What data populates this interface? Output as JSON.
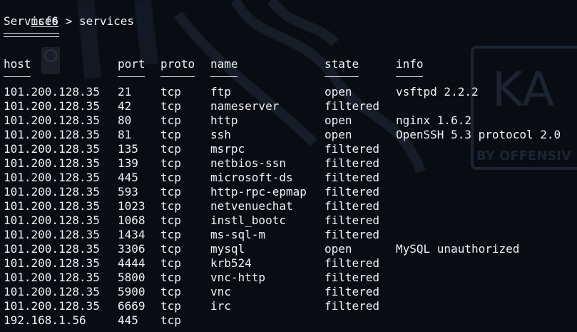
{
  "terminal": {
    "prompt_user": "msf6",
    "prompt_sep": " > ",
    "command": "services",
    "heading": "Services",
    "heading_rule": "========",
    "columns": {
      "host": "host",
      "port": "port",
      "proto": "proto",
      "name": "name",
      "state": "state",
      "info": "info"
    },
    "rows": [
      {
        "host": "101.200.128.35",
        "port": "21",
        "proto": "tcp",
        "name": "ftp",
        "state": "open",
        "info": "vsftpd 2.2.2"
      },
      {
        "host": "101.200.128.35",
        "port": "42",
        "proto": "tcp",
        "name": "nameserver",
        "state": "filtered",
        "info": ""
      },
      {
        "host": "101.200.128.35",
        "port": "80",
        "proto": "tcp",
        "name": "http",
        "state": "open",
        "info": "nginx 1.6.2"
      },
      {
        "host": "101.200.128.35",
        "port": "81",
        "proto": "tcp",
        "name": "ssh",
        "state": "open",
        "info": "OpenSSH 5.3 protocol 2.0"
      },
      {
        "host": "101.200.128.35",
        "port": "135",
        "proto": "tcp",
        "name": "msrpc",
        "state": "filtered",
        "info": ""
      },
      {
        "host": "101.200.128.35",
        "port": "139",
        "proto": "tcp",
        "name": "netbios-ssn",
        "state": "filtered",
        "info": ""
      },
      {
        "host": "101.200.128.35",
        "port": "445",
        "proto": "tcp",
        "name": "microsoft-ds",
        "state": "filtered",
        "info": ""
      },
      {
        "host": "101.200.128.35",
        "port": "593",
        "proto": "tcp",
        "name": "http-rpc-epmap",
        "state": "filtered",
        "info": ""
      },
      {
        "host": "101.200.128.35",
        "port": "1023",
        "proto": "tcp",
        "name": "netvenuechat",
        "state": "filtered",
        "info": ""
      },
      {
        "host": "101.200.128.35",
        "port": "1068",
        "proto": "tcp",
        "name": "instl_bootc",
        "state": "filtered",
        "info": ""
      },
      {
        "host": "101.200.128.35",
        "port": "1434",
        "proto": "tcp",
        "name": "ms-sql-m",
        "state": "filtered",
        "info": ""
      },
      {
        "host": "101.200.128.35",
        "port": "3306",
        "proto": "tcp",
        "name": "mysql",
        "state": "open",
        "info": "MySQL unauthorized"
      },
      {
        "host": "101.200.128.35",
        "port": "4444",
        "proto": "tcp",
        "name": "krb524",
        "state": "filtered",
        "info": ""
      },
      {
        "host": "101.200.128.35",
        "port": "5800",
        "proto": "tcp",
        "name": "vnc-http",
        "state": "filtered",
        "info": ""
      },
      {
        "host": "101.200.128.35",
        "port": "5900",
        "proto": "tcp",
        "name": "vnc",
        "state": "filtered",
        "info": ""
      },
      {
        "host": "101.200.128.35",
        "port": "6669",
        "proto": "tcp",
        "name": "irc",
        "state": "filtered",
        "info": ""
      },
      {
        "host": "192.168.1.56",
        "port": "445",
        "proto": "tcp",
        "name": "",
        "state": "",
        "info": ""
      }
    ]
  },
  "wallpaper": {
    "logo_text": "KA",
    "tagline": "BY OFFENSIV"
  },
  "colors": {
    "background": "#090c12",
    "text": "#eef1f5",
    "wallpaper_ink": "#1a2130"
  }
}
